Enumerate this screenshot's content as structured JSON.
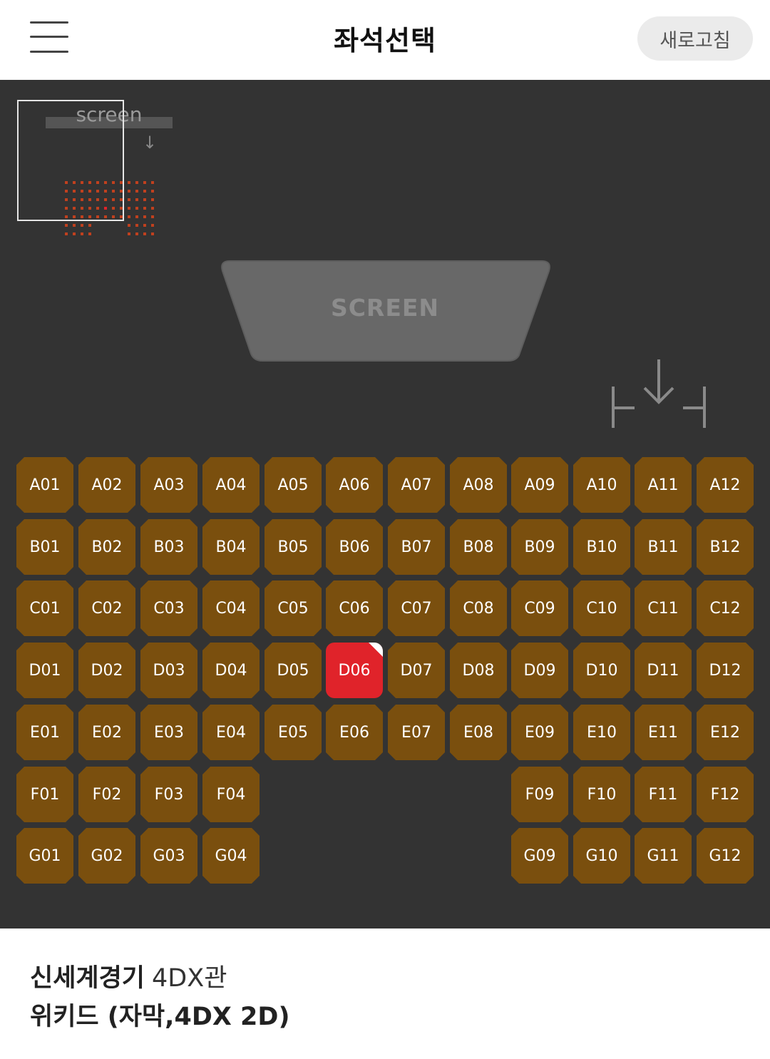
{
  "header": {
    "title": "좌석선택",
    "refresh_label": "새로고침"
  },
  "minimap": {
    "screen_label": "screen",
    "arrow": "↓"
  },
  "screen_label": "SCREEN",
  "seat_colors": {
    "available": "#7a4f0e",
    "selected": "#e0232a",
    "background": "#333333"
  },
  "selected_seat": "D06",
  "seat_rows": [
    {
      "row": "A",
      "seats": [
        "A01",
        "A02",
        "A03",
        "A04",
        "A05",
        "A06",
        "A07",
        "A08",
        "A09",
        "A10",
        "A11",
        "A12"
      ]
    },
    {
      "row": "B",
      "seats": [
        "B01",
        "B02",
        "B03",
        "B04",
        "B05",
        "B06",
        "B07",
        "B08",
        "B09",
        "B10",
        "B11",
        "B12"
      ]
    },
    {
      "row": "C",
      "seats": [
        "C01",
        "C02",
        "C03",
        "C04",
        "C05",
        "C06",
        "C07",
        "C08",
        "C09",
        "C10",
        "C11",
        "C12"
      ]
    },
    {
      "row": "D",
      "seats": [
        "D01",
        "D02",
        "D03",
        "D04",
        "D05",
        "D06",
        "D07",
        "D08",
        "D09",
        "D10",
        "D11",
        "D12"
      ]
    },
    {
      "row": "E",
      "seats": [
        "E01",
        "E02",
        "E03",
        "E04",
        "E05",
        "E06",
        "E07",
        "E08",
        "E09",
        "E10",
        "E11",
        "E12"
      ]
    },
    {
      "row": "F",
      "seats": [
        "F01",
        "F02",
        "F03",
        "F04",
        null,
        null,
        null,
        null,
        "F09",
        "F10",
        "F11",
        "F12"
      ]
    },
    {
      "row": "G",
      "seats": [
        "G01",
        "G02",
        "G03",
        "G04",
        null,
        null,
        null,
        null,
        "G09",
        "G10",
        "G11",
        "G12"
      ]
    }
  ],
  "info": {
    "theater_name": "신세계경기",
    "hall": "4DX관",
    "movie": "위키드 (자막,4DX 2D)"
  }
}
